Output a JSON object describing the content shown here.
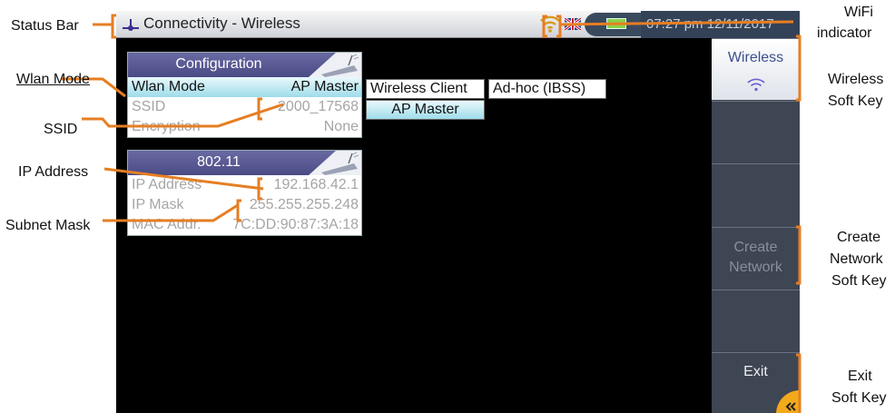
{
  "device": {
    "status_bar": {
      "title": "Connectivity - Wireless",
      "clock": "07:27 pm 12/11/2017",
      "icons": [
        "app-icon",
        "wifi-icon",
        "flag-icon",
        "battery-icon"
      ]
    },
    "config_panel": {
      "header": "Configuration",
      "rows": [
        {
          "label": "Wlan Mode",
          "value": "AP Master"
        },
        {
          "label": "SSID",
          "value": "2000_17568"
        },
        {
          "label": "Encryption",
          "value": "None"
        }
      ]
    },
    "net_panel": {
      "header": "802.11",
      "rows": [
        {
          "label": "IP Address",
          "value": "192.168.42.1"
        },
        {
          "label": "IP Mask",
          "value": "255.255.255.248"
        },
        {
          "label": "MAC Addr.",
          "value": "7C:DD:90:87:3A:18"
        }
      ]
    },
    "mode_options": {
      "client": "Wireless Client",
      "adhoc": "Ad-hoc (IBSS)",
      "ap_master": "AP Master"
    },
    "soft_keys": {
      "wireless": "Wireless",
      "create_network_1": "Create",
      "create_network_2": "Network",
      "exit": "Exit"
    }
  },
  "annotations": {
    "status_bar": "Status  Bar",
    "wlan_mode": "Wlan Mode",
    "ssid": "SSID",
    "ip_address": "IP Address",
    "subnet_mask": "Subnet Mask",
    "wifi_1": "WiFi",
    "wifi_2": "indicator",
    "wireless_1": "Wireless",
    "wireless_2": "Soft Key",
    "create_1": "Create",
    "create_2": "Network",
    "create_3": "Soft Key",
    "exit_1": "Exit",
    "exit_2": "Soft Key"
  },
  "colors": {
    "callout_line": "#e67e22",
    "panel_header": "#55558f",
    "selected_row": "#a6dfec",
    "softkey_bg": "#3e4553"
  }
}
